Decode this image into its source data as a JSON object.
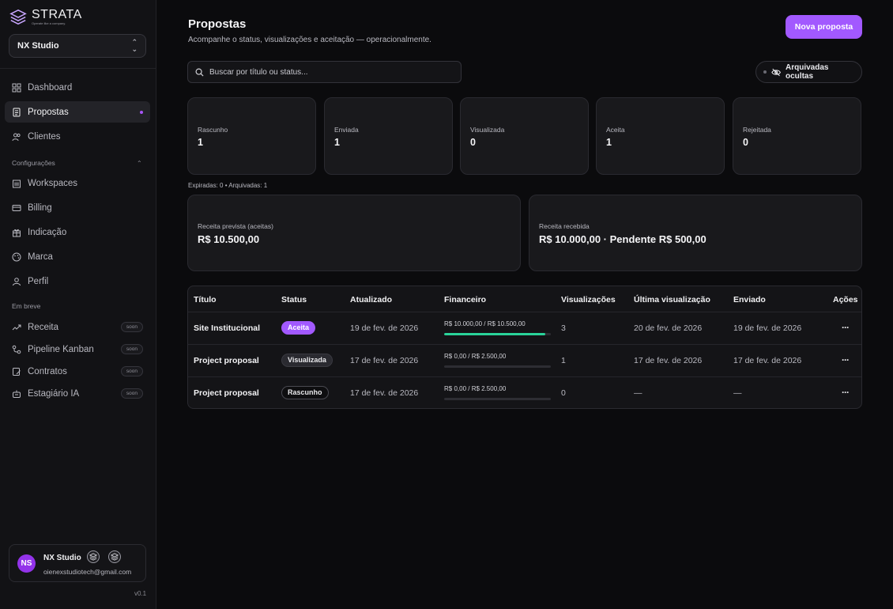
{
  "brand": {
    "name": "STRATA",
    "tagline": "Operate like a company."
  },
  "workspace": {
    "selected": "NX Studio"
  },
  "nav": [
    {
      "label": "Dashboard",
      "icon": "grid-icon"
    },
    {
      "label": "Propostas",
      "icon": "document-icon",
      "active": true
    },
    {
      "label": "Clientes",
      "icon": "users-icon"
    }
  ],
  "config_section": {
    "label": "Configurações",
    "items": [
      {
        "label": "Workspaces",
        "icon": "building-icon"
      },
      {
        "label": "Billing",
        "icon": "credit-card-icon"
      },
      {
        "label": "Indicação",
        "icon": "gift-icon"
      },
      {
        "label": "Marca",
        "icon": "palette-icon"
      },
      {
        "label": "Perfil",
        "icon": "user-icon"
      }
    ]
  },
  "soon_section": {
    "label": "Em breve",
    "badge": "soon",
    "items": [
      {
        "label": "Receita",
        "icon": "trend-icon"
      },
      {
        "label": "Pipeline Kanban",
        "icon": "pipeline-icon"
      },
      {
        "label": "Contratos",
        "icon": "contract-icon"
      },
      {
        "label": "Estagiário IA",
        "icon": "robot-icon"
      }
    ]
  },
  "user": {
    "initials": "NS",
    "name": "NX Studio",
    "email": "oienexstudiotech@gmail.com"
  },
  "version": "v0.1",
  "header": {
    "title": "Propostas",
    "subtitle": "Acompanhe o status, visualizações e aceitação — operacionalmente.",
    "new_button": "Nova proposta"
  },
  "search": {
    "placeholder": "Buscar por título ou status...",
    "value": ""
  },
  "archived_toggle": "Arquivadas ocultas",
  "stats": [
    {
      "label": "Rascunho",
      "value": "1"
    },
    {
      "label": "Enviada",
      "value": "1"
    },
    {
      "label": "Visualizada",
      "value": "0"
    },
    {
      "label": "Aceita",
      "value": "1"
    },
    {
      "label": "Rejeitada",
      "value": "0"
    }
  ],
  "stats_footer": "Expiradas: 0 • Arquivadas: 1",
  "revenue": {
    "forecast_label": "Receita prevista (aceitas)",
    "forecast_value": "R$ 10.500,00",
    "received_label": "Receita recebida",
    "received_value": "R$ 10.000,00 · Pendente R$ 500,00"
  },
  "table": {
    "headers": [
      "Título",
      "Status",
      "Atualizado",
      "Financeiro",
      "Visualizações",
      "Última visualização",
      "Enviado",
      "Ações"
    ],
    "rows": [
      {
        "title": "Site Institucional",
        "status": "Aceita",
        "updated": "19 de fev. de 2026",
        "financial": "R$ 10.000,00 / R$ 10.500,00",
        "paid_fraction": 0.95,
        "views": "3",
        "last_view": "20 de fev. de 2026",
        "sent": "19 de fev. de 2026",
        "actions": "···"
      },
      {
        "title": "Project proposal",
        "status": "Visualizada",
        "updated": "17 de fev. de 2026",
        "financial": "R$ 0,00 / R$ 2.500,00",
        "paid_fraction": 0,
        "views": "1",
        "last_view": "17 de fev. de 2026",
        "sent": "17 de fev. de 2026",
        "actions": "···"
      },
      {
        "title": "Project proposal",
        "status": "Rascunho",
        "updated": "17 de fev. de 2026",
        "financial": "R$ 0,00 / R$ 2.500,00",
        "paid_fraction": 0,
        "views": "0",
        "last_view": "—",
        "sent": "—",
        "actions": "···"
      }
    ]
  },
  "colors": {
    "accent": "#a259ff",
    "progress": "#2ad39a",
    "background": "#0b0b0d"
  }
}
